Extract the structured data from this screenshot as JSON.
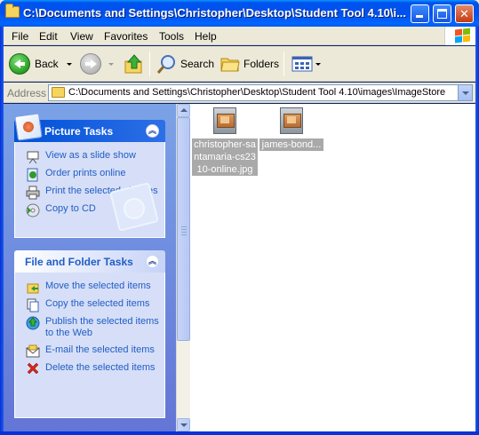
{
  "window": {
    "title": "C:\\Documents and Settings\\Christopher\\Desktop\\Student Tool 4.10\\i..."
  },
  "menu": {
    "items": [
      "File",
      "Edit",
      "View",
      "Favorites",
      "Tools",
      "Help"
    ]
  },
  "toolbar": {
    "back_label": "Back",
    "search_label": "Search",
    "folders_label": "Folders"
  },
  "address": {
    "label": "Address",
    "path": "C:\\Documents and Settings\\Christopher\\Desktop\\Student Tool 4.10\\images\\ImageStore"
  },
  "picture_tasks": {
    "title": "Picture Tasks",
    "items": [
      {
        "label": "View as a slide show",
        "icon": "slideshow-icon"
      },
      {
        "label": "Order prints online",
        "icon": "order-prints-icon"
      },
      {
        "label": "Print the selected pictures",
        "icon": "print-icon"
      },
      {
        "label": "Copy to CD",
        "icon": "cd-icon"
      }
    ]
  },
  "file_folder_tasks": {
    "title": "File and Folder Tasks",
    "items": [
      {
        "label": "Move the selected items",
        "icon": "move-icon"
      },
      {
        "label": "Copy the selected items",
        "icon": "copy-icon"
      },
      {
        "label": "Publish the selected items to the Web",
        "icon": "publish-web-icon"
      },
      {
        "label": "E-mail the selected items",
        "icon": "email-icon"
      },
      {
        "label": "Delete the selected items",
        "icon": "delete-icon"
      }
    ]
  },
  "files": [
    {
      "name": "christopher-santamaria-cs2310-online.jpg",
      "display_lines": [
        "christopher-sa",
        "ntamaria-cs23",
        "10-online.jpg"
      ],
      "selected": true
    },
    {
      "name": "james-bond...",
      "display_lines": [
        "james-bond..."
      ],
      "selected": true
    }
  ],
  "colors": {
    "titlebar": "#0050ee",
    "task_link": "#215dc6",
    "selection": "#a9a9a9"
  }
}
